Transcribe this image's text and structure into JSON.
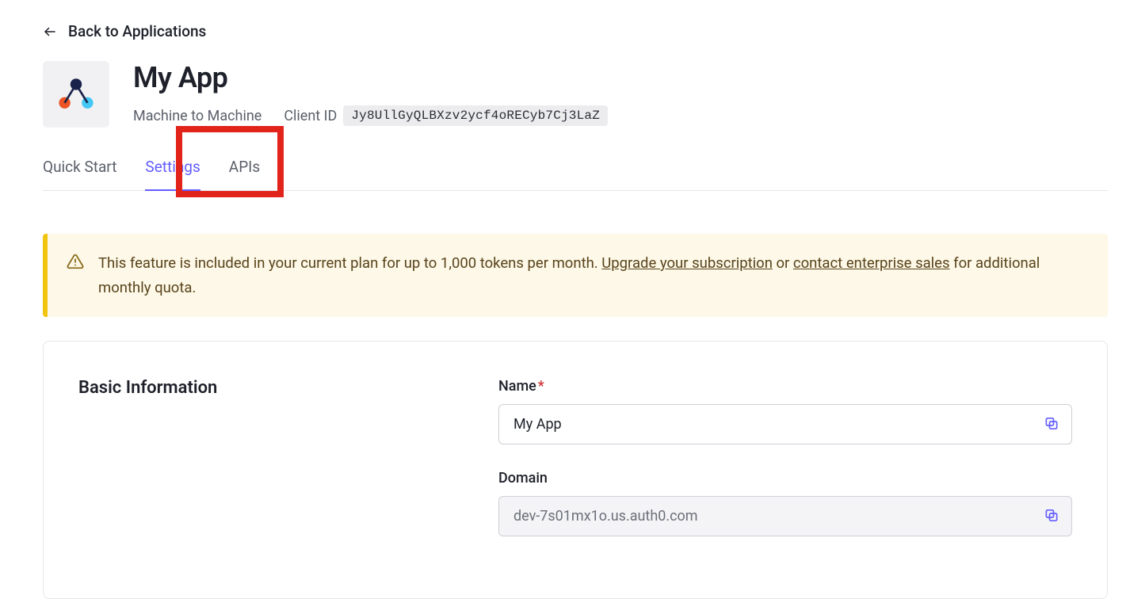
{
  "back": {
    "label": "Back to Applications"
  },
  "app": {
    "name": "My App",
    "type": "Machine to Machine",
    "client_id_label": "Client ID",
    "client_id": "Jy8UllGyQLBXzv2ycf4oRECyb7Cj3LaZ"
  },
  "tabs": {
    "quick_start": "Quick Start",
    "settings": "Settings",
    "apis": "APIs"
  },
  "alert": {
    "text_before": "This feature is included in your current plan for up to 1,000 tokens per month. ",
    "upgrade_link": "Upgrade your subscription",
    "text_mid": " or ",
    "sales_link": "contact enterprise sales",
    "text_after": " for additional monthly quota."
  },
  "section": {
    "basic_info": "Basic Information"
  },
  "fields": {
    "name": {
      "label": "Name",
      "value": "My App"
    },
    "domain": {
      "label": "Domain",
      "value": "dev-7s01mx1o.us.auth0.com"
    }
  }
}
